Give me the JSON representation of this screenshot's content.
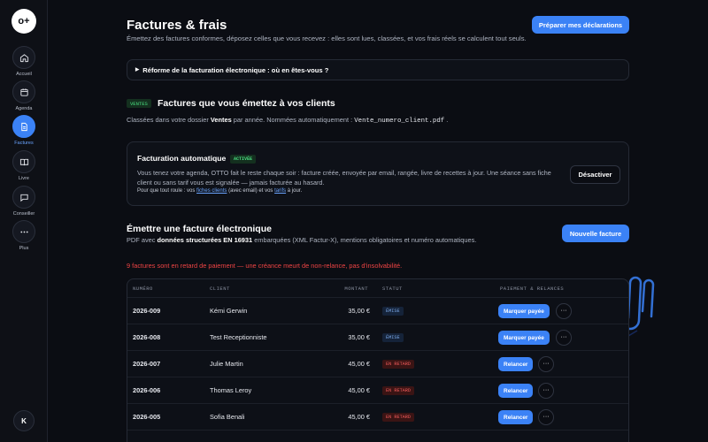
{
  "sidebar": {
    "logo_text": "o+",
    "items": [
      {
        "label": "Accueil",
        "icon": "home-icon"
      },
      {
        "label": "Agenda",
        "icon": "calendar-icon"
      },
      {
        "label": "Factures",
        "icon": "document-icon",
        "active": true
      },
      {
        "label": "Livre",
        "icon": "book-icon"
      },
      {
        "label": "Conseiller",
        "icon": "chat-icon"
      },
      {
        "label": "Plus",
        "icon": "more-icon"
      }
    ],
    "avatar_initial": "K"
  },
  "header": {
    "title": "Factures & frais",
    "subtitle": "Émettez des factures conformes, déposez celles que vous recevez : elles sont lues, classées, et vos frais réels se calculent tout seuls.",
    "prepare_button": "Préparer mes déclarations"
  },
  "reform_disclosure": {
    "label": "Réforme de la facturation électronique : où en êtes-vous ?"
  },
  "issued_section": {
    "badge": "VENTES",
    "title": "Factures que vous émettez à vos clients",
    "desc_prefix": "Classées dans votre dossier",
    "desc_strong": "Ventes",
    "desc_middle": "par année. Nommées automatiquement :",
    "desc_filename": "Vente_numero_client.pdf",
    "desc_suffix": "."
  },
  "auto_billing": {
    "title": "Facturation automatique",
    "status_badge": "ACTIVÉE",
    "description": "Vous tenez votre agenda, OTTO fait le reste chaque soir : facture créée, envoyée par email, rangée, livre de recettes à jour. Une séance sans fiche client ou sans tarif vous est signalée — jamais facturée au hasard.",
    "note_prefix": "Pour que tout roule : vos",
    "note_link1": "fiches clients",
    "note_middle": "(avec email) et vos",
    "note_link2": "tarifs",
    "note_suffix": "à jour.",
    "deactivate_button": "Désactiver"
  },
  "emit_section": {
    "title": "Émettre une facture électronique",
    "desc_prefix": "PDF avec",
    "desc_strong": "données structurées EN 16931",
    "desc_suffix": "embarquées (XML Factur-X), mentions obligatoires et numéro automatiques.",
    "new_button": "Nouvelle facture"
  },
  "alert": "9 factures sont en retard de paiement — une créance meurt de non-relance, pas d'insolvabilité.",
  "table": {
    "headers": [
      "NUMÉRO",
      "CLIENT",
      "MONTANT",
      "STATUT",
      "PAIEMENT & RELANCES"
    ],
    "more_label": "···",
    "rows": [
      {
        "number": "2026-009",
        "client": "Kémi Gerwin",
        "amount": "35,00 €",
        "status": "ÉMISE",
        "action": "Marquer payée"
      },
      {
        "number": "2026-008",
        "client": "Test Receptionniste",
        "amount": "35,00 €",
        "status": "ÉMISE",
        "action": "Marquer payée"
      },
      {
        "number": "2026-007",
        "client": "Julie Martin",
        "amount": "45,00 €",
        "status": "EN RETARD",
        "action": "Relancer"
      },
      {
        "number": "2026-006",
        "client": "Thomas Leroy",
        "amount": "45,00 €",
        "status": "EN RETARD",
        "action": "Relancer"
      },
      {
        "number": "2026-005",
        "client": "Sofia Benali",
        "amount": "45,00 €",
        "status": "EN RETARD",
        "action": "Relancer"
      }
    ]
  },
  "colors": {
    "accent": "#3b82f6",
    "success": "#4ade80",
    "danger": "#ef4444",
    "background": "#0b0d13"
  }
}
